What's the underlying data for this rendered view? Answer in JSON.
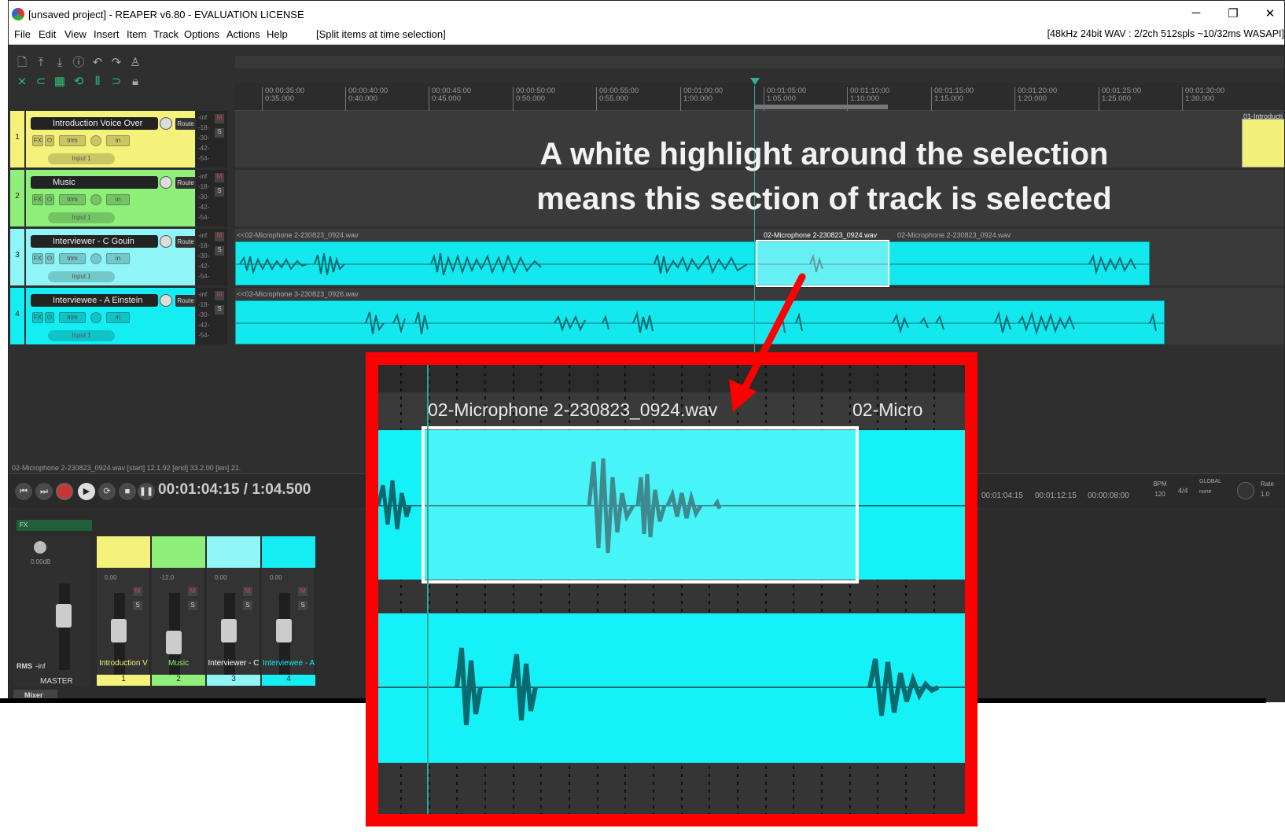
{
  "window": {
    "title": "[unsaved project] - REAPER v6.80 - EVALUATION LICENSE",
    "minimize": "─",
    "maximize": "❐",
    "close": "✕"
  },
  "menu": {
    "items": [
      "File",
      "Edit",
      "View",
      "Insert",
      "Item",
      "Track",
      "Options",
      "Actions",
      "Help"
    ],
    "hint": "[Split items at time selection]",
    "status": "[48kHz 24bit WAV : 2/2ch 512spls ~10/32ms WASAPI]"
  },
  "ruler": {
    "ticks": [
      {
        "time": "00:00:35:00",
        "sub": "0:35.000"
      },
      {
        "time": "00:00:40:00",
        "sub": "0:40.000"
      },
      {
        "time": "00:00:45:00",
        "sub": "0:45.000"
      },
      {
        "time": "00:00:50:00",
        "sub": "0:50.000"
      },
      {
        "time": "00:00:55:00",
        "sub": "0:55.000"
      },
      {
        "time": "00:01:00:00",
        "sub": "1:00.000"
      },
      {
        "time": "00:01:05:00",
        "sub": "1:05.000"
      },
      {
        "time": "00:01:10:00",
        "sub": "1:10.000"
      },
      {
        "time": "00:01:15:00",
        "sub": "1:15.000"
      },
      {
        "time": "00:01:20:00",
        "sub": "1:20.000"
      },
      {
        "time": "00:01:25:00",
        "sub": "1:25.000"
      },
      {
        "time": "00:01:30:00",
        "sub": "1:30.000"
      }
    ]
  },
  "tracks": [
    {
      "num": "1",
      "name": "Introduction Voice Over",
      "color": "#f5f27c",
      "route": "Route",
      "fx": "FX",
      "trim": "trim",
      "in": "in",
      "input": "Input 1"
    },
    {
      "num": "2",
      "name": "Music",
      "color": "#8ef07a",
      "route": "Route",
      "fx": "FX",
      "trim": "trim",
      "in": "in",
      "input": "Input 1"
    },
    {
      "num": "3",
      "name": "Interviewer - C Gouin",
      "color": "#8ff5f7",
      "route": "Route",
      "fx": "FX",
      "trim": "trim",
      "in": "in",
      "input": "Input 1"
    },
    {
      "num": "4",
      "name": "Interviewee - A Einstein",
      "color": "#14eef3",
      "route": "Route",
      "fx": "FX",
      "trim": "trim",
      "in": "in",
      "input": "Input 1"
    }
  ],
  "meter_labels": [
    "-inf",
    "-18-",
    "-30-",
    "-42-",
    "-54-"
  ],
  "items": {
    "track1_label": "01-Introducti",
    "track3_label_a": "<<02-Microphone 2-230823_0924.wav",
    "track3_label_b": "02-Microphone 2-230823_0924.wav",
    "track3_label_c": "02-Microphone 2-230823_0924.wav",
    "track4_label": "<<03-Microphone 3-230823_0926.wav"
  },
  "info_line": "02-Microphone 2-230823_0924.wav [start] 12.1.92 [end] 33.2.00 [len] 21.",
  "transport": {
    "timecode": "00:01:04:15 / 1:04.500",
    "sel_start": "00:01:04:15",
    "sel_end": "00:01:12:15",
    "sel_len": "00:00:08:00",
    "bpm_label": "BPM",
    "bpm": "120",
    "sig": "4/4",
    "global": "GLOBAL",
    "none": "none",
    "rate_label": "Rate",
    "rate": "1.0"
  },
  "mixer": {
    "master_label": "MASTER",
    "rms": "RMS",
    "inf": "-inf",
    "master_db": "0.00dB",
    "strips": [
      {
        "name": "Introduction V",
        "num": "1",
        "color": "#f5f27c",
        "vol": "0.00",
        "namecolor": "#f5f27c"
      },
      {
        "name": "Music",
        "num": "2",
        "color": "#8ef07a",
        "vol": "-12.0",
        "namecolor": "#8ef07a"
      },
      {
        "name": "Interviewer - C",
        "num": "3",
        "color": "#8ff5f7",
        "vol": "0.00",
        "namecolor": "#ffffff"
      },
      {
        "name": "Interviewee - A",
        "num": "4",
        "color": "#14eef3",
        "vol": "0.00",
        "namecolor": "#14eef3"
      }
    ],
    "tab": "Mixer"
  },
  "callout": {
    "line1": "A white highlight around the selection",
    "line2": "means this section of track is selected"
  },
  "zoom": {
    "label_main": "02-Microphone 2-230823_0924.wav",
    "label_next": "02-Micro"
  },
  "colors": {
    "item": "#14e8ef",
    "selection_border": "#ffffff",
    "callout_frame": "#ff0000",
    "arrow": "#ff0000"
  }
}
